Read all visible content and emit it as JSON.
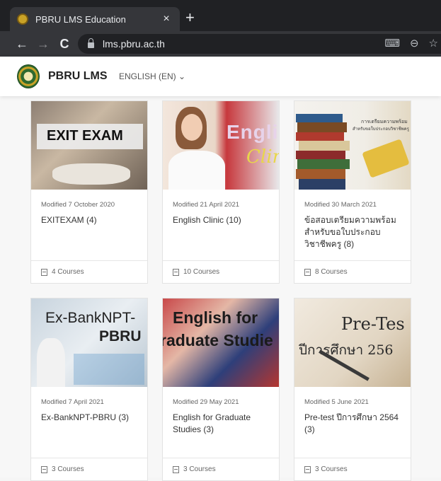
{
  "browser": {
    "tab_title": "PBRU LMS Education",
    "tab_close": "×",
    "new_tab": "+",
    "url": "lms.pbru.ac.th",
    "back": "←",
    "forward": "→",
    "reload": "C",
    "translate_icon": "⌨",
    "zoom_icon": "⊖",
    "bookmark_icon": "☆"
  },
  "site": {
    "brand": "PBRU LMS",
    "language": "ENGLISH (EN) ⌄"
  },
  "categories": [
    {
      "modified": "Modified 7 October 2020",
      "name": "EXITEXAM (4)",
      "courses": "4 Courses",
      "thumb_text": "EXIT EXAM"
    },
    {
      "modified": "Modified 21 April 2021",
      "name": "English Clinic (10)",
      "courses": "10 Courses",
      "thumb_text": "Englis"
    },
    {
      "modified": "Modified 30 March 2021",
      "name": "ข้อสอบเตรียมความพร้อม สำหรับขอใบประกอบวิชาชีพครู (8)",
      "courses": "8 Courses",
      "thumb_text": "การเตรียมความพร้อม"
    },
    {
      "modified": "Modified 7 April 2021",
      "name": "Ex-BankNPT-PBRU (3)",
      "courses": "3 Courses",
      "thumb_text": "Ex-BankNPT-"
    },
    {
      "modified": "Modified 29 May 2021",
      "name": "English for Graduate Studies (3)",
      "courses": "3 Courses",
      "thumb_text": "English for"
    },
    {
      "modified": "Modified 5 June 2021",
      "name": "Pre-test ปีการศึกษา 2564 (3)",
      "courses": "3 Courses",
      "thumb_text": "Pre-Tes"
    }
  ],
  "thumb_extra": {
    "clinic": "Clin",
    "pbru": "PBRU",
    "graduate": "raduate Studie",
    "year": "ปีการศึกษา 256",
    "thai_sub": "สำหรับขอใบประกอบวิชาชีพครู"
  }
}
